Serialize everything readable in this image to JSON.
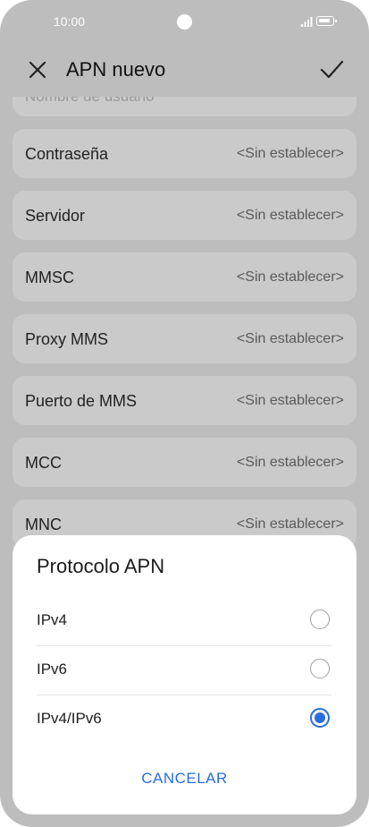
{
  "status_bar": {
    "time": "10:00"
  },
  "header": {
    "title": "APN nuevo"
  },
  "partial_item": {
    "label": "Nombre de usuario"
  },
  "items": [
    {
      "label": "Contraseña",
      "value": "<Sin establecer>"
    },
    {
      "label": "Servidor",
      "value": "<Sin establecer>"
    },
    {
      "label": "MMSC",
      "value": "<Sin establecer>"
    },
    {
      "label": "Proxy MMS",
      "value": "<Sin establecer>"
    },
    {
      "label": "Puerto de MMS",
      "value": "<Sin establecer>"
    },
    {
      "label": "MCC",
      "value": "<Sin establecer>"
    },
    {
      "label": "MNC",
      "value": "<Sin establecer>"
    }
  ],
  "dialog": {
    "title": "Protocolo APN",
    "options": [
      {
        "label": "IPv4",
        "selected": false
      },
      {
        "label": "IPv6",
        "selected": false
      },
      {
        "label": "IPv4/IPv6",
        "selected": true
      }
    ],
    "cancel_label": "CANCELAR"
  },
  "colors": {
    "accent": "#2a6de0"
  }
}
